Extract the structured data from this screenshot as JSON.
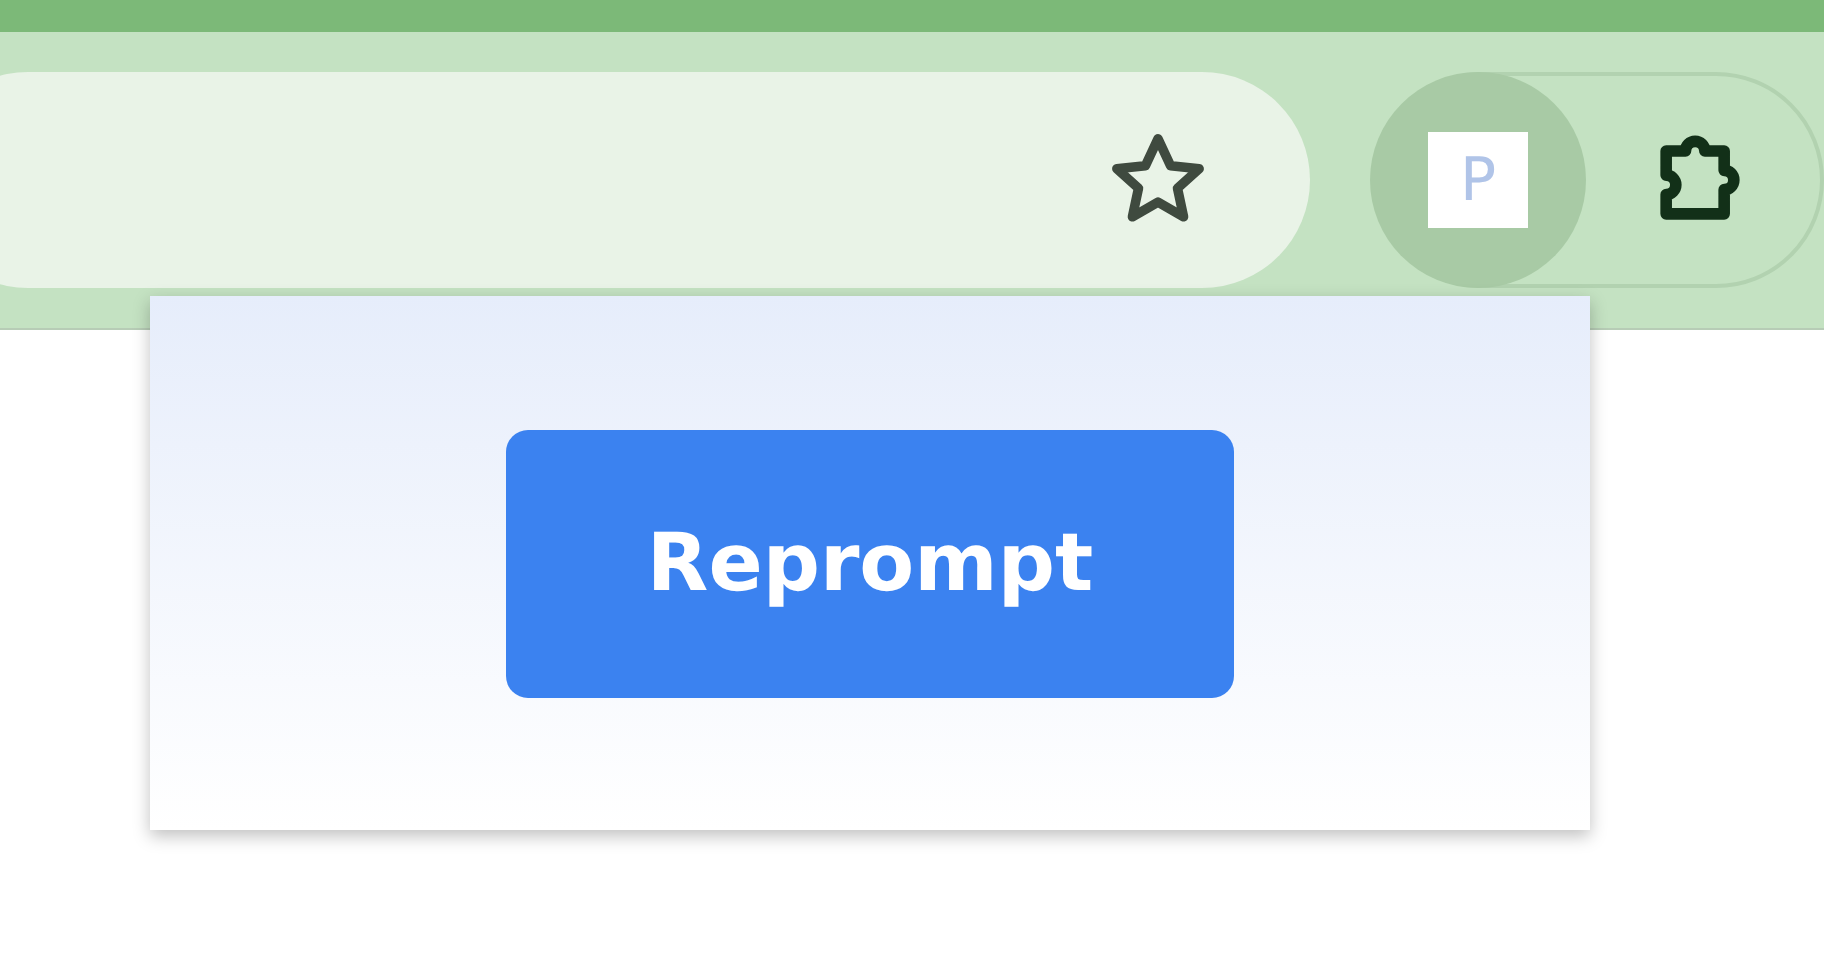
{
  "toolbar": {
    "extension_label": "P"
  },
  "popup": {
    "button": "Reprompt"
  }
}
